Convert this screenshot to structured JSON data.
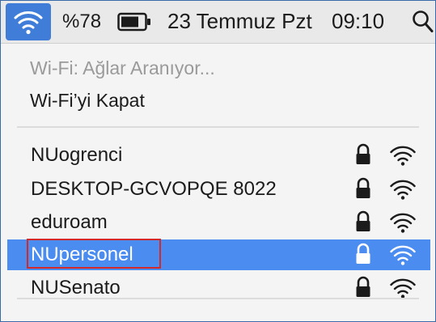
{
  "menubar": {
    "wifi_icon": "wifi-icon",
    "battery_percent": "%78",
    "battery_icon": "battery-icon",
    "date": "23 Temmuz Pzt",
    "time": "09:10",
    "search_icon": "search-icon"
  },
  "wifi_menu": {
    "status": "Wi-Fi: Ağlar Aranıyor...",
    "toggle_label": "Wi-Fi’yi Kapat",
    "networks": [
      {
        "name": "NUogrenci",
        "secured": true,
        "selected": false
      },
      {
        "name": "DESKTOP-GCVOPQE 8022",
        "secured": true,
        "selected": false
      },
      {
        "name": "eduroam",
        "secured": true,
        "selected": false
      },
      {
        "name": "NUpersonel",
        "secured": true,
        "selected": true
      },
      {
        "name": "NUSenato",
        "secured": true,
        "selected": false
      }
    ]
  },
  "colors": {
    "selection": "#4b8cf0",
    "wifi_tile": "#3f7dd8",
    "annotation_box": "#d22a2a",
    "menu_background": "#f4f4f4"
  }
}
